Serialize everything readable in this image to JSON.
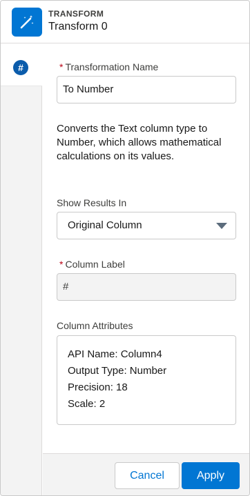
{
  "header": {
    "eyebrow": "TRANSFORM",
    "title": "Transform 0",
    "icon": "magic-wand-icon",
    "accent_color": "#0176d3"
  },
  "rail": {
    "active_tab_icon": "#"
  },
  "form": {
    "transformation_name_label": "Transformation Name",
    "transformation_name_value": "To Number",
    "description": "Converts the Text column type to Number, which allows mathematical calculations on its values.",
    "show_results_label": "Show Results In",
    "show_results_value": "Original Column",
    "column_label_label": "Column Label",
    "column_label_value": "#",
    "column_attributes_label": "Column Attributes",
    "attributes": [
      "API Name: Column4",
      "Output Type: Number",
      "Precision: 18",
      "Scale: 2"
    ],
    "required_marker": "*"
  },
  "footer": {
    "cancel_label": "Cancel",
    "apply_label": "Apply"
  }
}
